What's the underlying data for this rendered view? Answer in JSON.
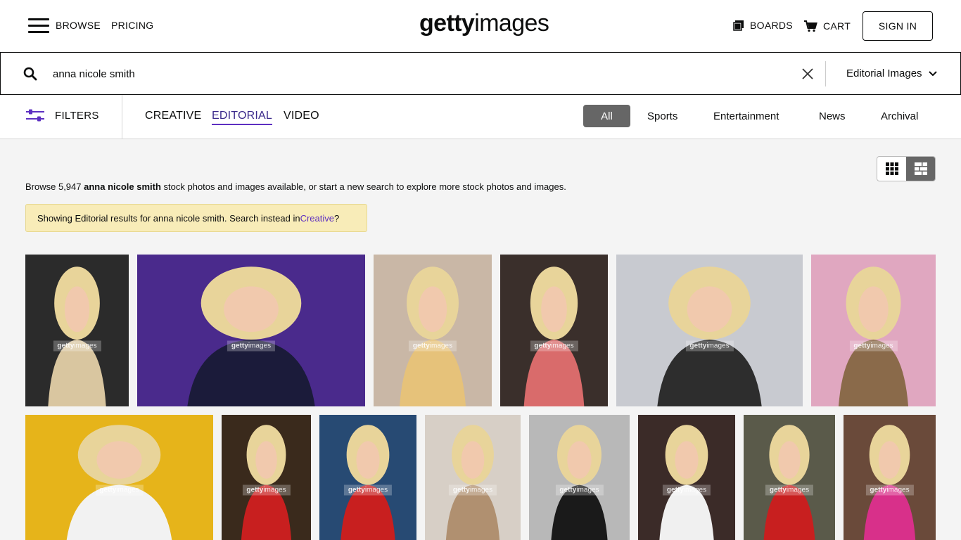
{
  "header": {
    "browse_label": "BROWSE",
    "pricing_label": "PRICING",
    "logo_bold": "getty",
    "logo_light": "images",
    "boards_label": "BOARDS",
    "cart_label": "CART",
    "signin_label": "SIGN IN"
  },
  "search": {
    "query": "anna nicole smith",
    "type_label": "Editorial Images"
  },
  "filterbar": {
    "filters_label": "FILTERS",
    "asset_tabs": [
      "CREATIVE",
      "EDITORIAL",
      "VIDEO"
    ],
    "active_tab": "EDITORIAL",
    "categories": [
      "All",
      "Sports",
      "Entertainment",
      "News",
      "Archival"
    ],
    "active_category": "All"
  },
  "results": {
    "browse_prefix": "Browse 5,947 ",
    "browse_query": "anna nicole smith",
    "browse_suffix": " stock photos and images available, or start a new search to explore more stock photos and images.",
    "notice_prefix": "Showing Editorial results for anna nicole smith. Search instead in ",
    "notice_link": "Creative",
    "notice_suffix": "?"
  },
  "watermark": {
    "bold": "getty",
    "light": "images"
  },
  "images": [
    {
      "bg": "#2b2b2b",
      "accent": "#d9c6a0"
    },
    {
      "bg": "#4a2a8c",
      "accent": "#1b1b3a"
    },
    {
      "bg": "#c9b7a6",
      "accent": "#e6c27a"
    },
    {
      "bg": "#3a2f2b",
      "accent": "#d96b6b"
    },
    {
      "bg": "#c8cad0",
      "accent": "#2d2d2d"
    },
    {
      "bg": "#e0a7c0",
      "accent": "#8a6a4a"
    },
    {
      "bg": "#e6b41a",
      "accent": "#f2f2f2"
    },
    {
      "bg": "#3a2a1c",
      "accent": "#c81f1f"
    },
    {
      "bg": "#274a73",
      "accent": "#c81f1f"
    },
    {
      "bg": "#d7cfc6",
      "accent": "#b09070"
    },
    {
      "bg": "#b8b8b8",
      "accent": "#1a1a1a"
    },
    {
      "bg": "#3b2b28",
      "accent": "#f0f0f0"
    },
    {
      "bg": "#5a5a4a",
      "accent": "#c81f1f"
    },
    {
      "bg": "#6a4a3a",
      "accent": "#d8308a"
    }
  ],
  "colors": {
    "accent": "#5d2fc1",
    "notice_bg": "#f8ecb8",
    "pill_active": "#666666"
  }
}
